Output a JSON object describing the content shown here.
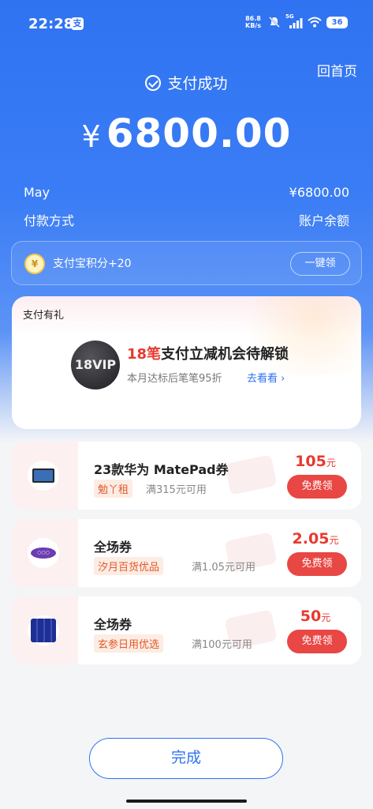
{
  "status_bar": {
    "time": "22:28",
    "app_glyph": "支",
    "net_speed_value": "86.8",
    "net_speed_unit": "KB/s",
    "network": "5G",
    "battery": "36"
  },
  "header": {
    "home_link": "回首页",
    "success_text": "支付成功",
    "currency": "¥",
    "amount": "6800.00"
  },
  "details": {
    "payee": "May",
    "payee_amount": "¥6800.00",
    "method_label": "付款方式",
    "method_value": "账户余额"
  },
  "points": {
    "coin_glyph": "¥",
    "text": "支付宝积分+20",
    "claim_all": "一键领"
  },
  "gift": {
    "section_title": "支付有礼",
    "badge": "18VIP",
    "headline_highlight": "18笔",
    "headline_rest": "支付立减机会待解锁",
    "subtitle": "本月达标后笔笔95折",
    "link": "去看看"
  },
  "coupons": [
    {
      "name": "23款华为 MatePad券",
      "tag": "勉丫租",
      "condition": "满315元可用",
      "value": "105",
      "unit": "元",
      "button": "免费领",
      "icon": "tablet-icon"
    },
    {
      "name": "全场券",
      "tag": "汐月百货优品",
      "condition": "满1.05元可用",
      "value": "2.05",
      "unit": "元",
      "button": "免费领",
      "icon": "brand-logo-icon"
    },
    {
      "name": "全场券",
      "tag": "玄参日用优选",
      "condition": "满100元可用",
      "value": "50",
      "unit": "元",
      "button": "免费领",
      "icon": "product-box-icon"
    }
  ],
  "footer": {
    "done": "完成"
  },
  "colors": {
    "primary_blue": "#2f73f2",
    "accent_red": "#e8392f",
    "button_red": "#e84744"
  }
}
